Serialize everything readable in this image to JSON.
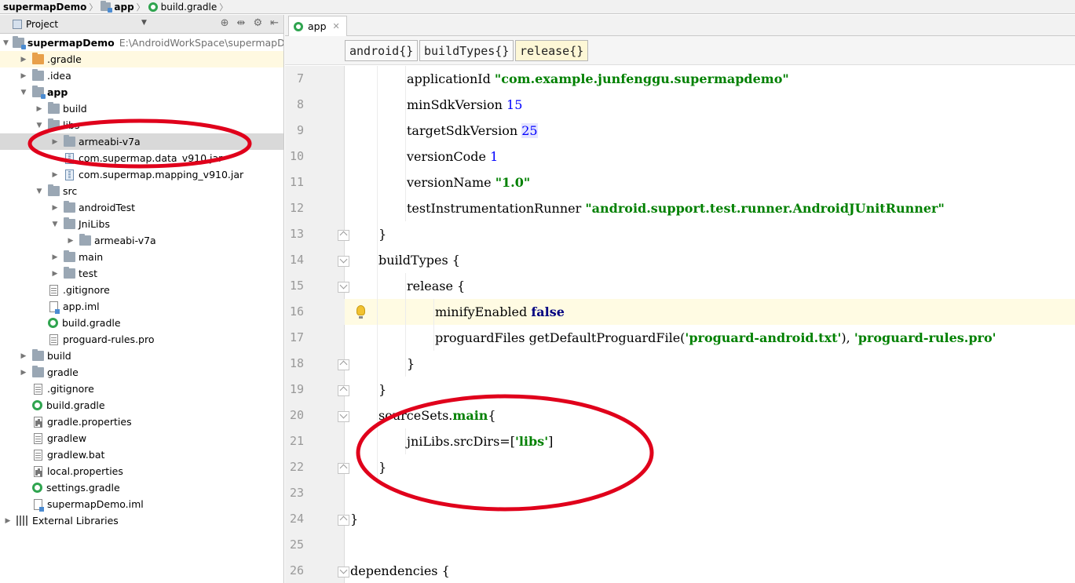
{
  "breadcrumb": [
    "supermapDemo",
    "app",
    "build.gradle"
  ],
  "project_panel": {
    "title": "Project",
    "tree": [
      {
        "label": "supermapDemo",
        "path": "E:\\AndroidWorkSpace\\supermapDen",
        "icon": "module-folder-icon",
        "depth": 0,
        "expanded": true,
        "bold": true
      },
      {
        "label": ".gradle",
        "icon": "orange-folder-icon",
        "depth": 1,
        "expanded": false,
        "highlight": true
      },
      {
        "label": ".idea",
        "icon": "folder-icon",
        "depth": 1,
        "expanded": false
      },
      {
        "label": "app",
        "icon": "module-folder-icon",
        "depth": 1,
        "expanded": true,
        "bold": true
      },
      {
        "label": "build",
        "icon": "folder-icon",
        "depth": 2,
        "expanded": false
      },
      {
        "label": "libs",
        "icon": "folder-icon",
        "depth": 2,
        "expanded": true
      },
      {
        "label": "armeabi-v7a",
        "icon": "folder-icon",
        "depth": 3,
        "expanded": false,
        "selected": true
      },
      {
        "label": "com.supermap.data_v910.jar",
        "icon": "jar-icon",
        "depth": 3,
        "expanded": null
      },
      {
        "label": "com.supermap.mapping_v910.jar",
        "icon": "jar-icon",
        "depth": 3,
        "expanded": false
      },
      {
        "label": "src",
        "icon": "folder-icon",
        "depth": 2,
        "expanded": true
      },
      {
        "label": "androidTest",
        "icon": "folder-icon",
        "depth": 3,
        "expanded": false
      },
      {
        "label": "JniLibs",
        "icon": "folder-icon",
        "depth": 3,
        "expanded": true
      },
      {
        "label": "armeabi-v7a",
        "icon": "folder-icon",
        "depth": 4,
        "expanded": false
      },
      {
        "label": "main",
        "icon": "folder-icon",
        "depth": 3,
        "expanded": false
      },
      {
        "label": "test",
        "icon": "folder-icon",
        "depth": 3,
        "expanded": false
      },
      {
        "label": ".gitignore",
        "icon": "file-icon",
        "depth": 2,
        "expanded": null
      },
      {
        "label": "app.iml",
        "icon": "iml-file-icon",
        "depth": 2,
        "expanded": null
      },
      {
        "label": "build.gradle",
        "icon": "gradle-icon",
        "depth": 2,
        "expanded": null
      },
      {
        "label": "proguard-rules.pro",
        "icon": "file-icon",
        "depth": 2,
        "expanded": null
      },
      {
        "label": "build",
        "icon": "folder-icon",
        "depth": 1,
        "expanded": false
      },
      {
        "label": "gradle",
        "icon": "folder-icon",
        "depth": 1,
        "expanded": false
      },
      {
        "label": ".gitignore",
        "icon": "file-icon",
        "depth": 1,
        "expanded": null
      },
      {
        "label": "build.gradle",
        "icon": "gradle-icon",
        "depth": 1,
        "expanded": null
      },
      {
        "label": "gradle.properties",
        "icon": "properties-file-icon",
        "depth": 1,
        "expanded": null
      },
      {
        "label": "gradlew",
        "icon": "file-icon",
        "depth": 1,
        "expanded": null
      },
      {
        "label": "gradlew.bat",
        "icon": "file-icon",
        "depth": 1,
        "expanded": null
      },
      {
        "label": "local.properties",
        "icon": "properties-file-icon",
        "depth": 1,
        "expanded": null
      },
      {
        "label": "settings.gradle",
        "icon": "gradle-icon",
        "depth": 1,
        "expanded": null
      },
      {
        "label": "supermapDemo.iml",
        "icon": "iml-file-icon",
        "depth": 1,
        "expanded": null
      },
      {
        "label": "External Libraries",
        "icon": "libraries-icon",
        "depth": 0,
        "expanded": false
      }
    ]
  },
  "editor": {
    "tab": {
      "label": "app",
      "close_icon": "close-icon"
    },
    "breadcrumbs": [
      {
        "label": "android{}",
        "active": false
      },
      {
        "label": "buildTypes{}",
        "active": false
      },
      {
        "label": "release{}",
        "active": true
      }
    ],
    "lines": [
      {
        "num": "7",
        "indent": 2,
        "fold": null,
        "tokens": [
          {
            "t": "applicationId ",
            "c": "plain"
          },
          {
            "t": "\"com.example.junfenggu.supermapdemo\"",
            "c": "str"
          }
        ]
      },
      {
        "num": "8",
        "indent": 2,
        "fold": null,
        "tokens": [
          {
            "t": "minSdkVersion ",
            "c": "plain"
          },
          {
            "t": "15",
            "c": "num"
          }
        ]
      },
      {
        "num": "9",
        "indent": 2,
        "fold": null,
        "tokens": [
          {
            "t": "targetSdkVersion ",
            "c": "plain"
          },
          {
            "t": "25",
            "c": "numhl"
          }
        ]
      },
      {
        "num": "10",
        "indent": 2,
        "fold": null,
        "tokens": [
          {
            "t": "versionCode ",
            "c": "plain"
          },
          {
            "t": "1",
            "c": "num"
          }
        ]
      },
      {
        "num": "11",
        "indent": 2,
        "fold": null,
        "tokens": [
          {
            "t": "versionName ",
            "c": "plain"
          },
          {
            "t": "\"1.0\"",
            "c": "str"
          }
        ]
      },
      {
        "num": "12",
        "indent": 2,
        "fold": null,
        "tokens": [
          {
            "t": "testInstrumentationRunner ",
            "c": "plain"
          },
          {
            "t": "\"android.support.test.runner.AndroidJUnitRunner\"",
            "c": "str"
          }
        ]
      },
      {
        "num": "13",
        "indent": 1,
        "fold": "up",
        "tokens": [
          {
            "t": "}",
            "c": "plain"
          }
        ]
      },
      {
        "num": "14",
        "indent": 1,
        "fold": "down",
        "tokens": [
          {
            "t": "buildTypes {",
            "c": "plain"
          }
        ]
      },
      {
        "num": "15",
        "indent": 2,
        "fold": "down",
        "tokens": [
          {
            "t": "release {",
            "c": "plain"
          }
        ]
      },
      {
        "num": "16",
        "indent": 3,
        "fold": null,
        "highlight": true,
        "bulb": true,
        "tokens": [
          {
            "t": "minifyEnabled ",
            "c": "plain"
          },
          {
            "t": "false",
            "c": "kw"
          }
        ]
      },
      {
        "num": "17",
        "indent": 3,
        "fold": null,
        "tokens": [
          {
            "t": "proguardFiles getDefaultProguardFile(",
            "c": "plain"
          },
          {
            "t": "'proguard-android.txt'",
            "c": "str"
          },
          {
            "t": "), ",
            "c": "plain"
          },
          {
            "t": "'proguard-rules.pro'",
            "c": "str"
          }
        ]
      },
      {
        "num": "18",
        "indent": 2,
        "fold": "up",
        "tokens": [
          {
            "t": "}",
            "c": "plain"
          }
        ]
      },
      {
        "num": "19",
        "indent": 1,
        "fold": "up",
        "tokens": [
          {
            "t": "}",
            "c": "plain"
          }
        ]
      },
      {
        "num": "20",
        "indent": 1,
        "fold": "down",
        "tokens": [
          {
            "t": "sourceSets.",
            "c": "plain"
          },
          {
            "t": "main",
            "c": "str"
          },
          {
            "t": "{",
            "c": "plain"
          }
        ]
      },
      {
        "num": "21",
        "indent": 2,
        "fold": null,
        "tokens": [
          {
            "t": "jniLibs.srcDirs=[",
            "c": "plain"
          },
          {
            "t": "'libs'",
            "c": "str"
          },
          {
            "t": "]",
            "c": "plain"
          }
        ]
      },
      {
        "num": "22",
        "indent": 1,
        "fold": "up",
        "tokens": [
          {
            "t": "}",
            "c": "plain"
          }
        ]
      },
      {
        "num": "23",
        "indent": 0,
        "fold": null,
        "tokens": []
      },
      {
        "num": "24",
        "indent": 0,
        "fold": "up",
        "tokens": [
          {
            "t": "}",
            "c": "plain"
          }
        ]
      },
      {
        "num": "25",
        "indent": 0,
        "fold": null,
        "tokens": []
      },
      {
        "num": "26",
        "indent": 0,
        "fold": "down",
        "tokens": [
          {
            "t": "dependencies {",
            "c": "plain"
          }
        ]
      }
    ]
  },
  "colors": {
    "string": "#008000",
    "keyword": "#000080",
    "number": "#0000ff",
    "annotation": "#e0001b",
    "selection": "#d9d9d9",
    "current_line": "#fffbe3"
  }
}
